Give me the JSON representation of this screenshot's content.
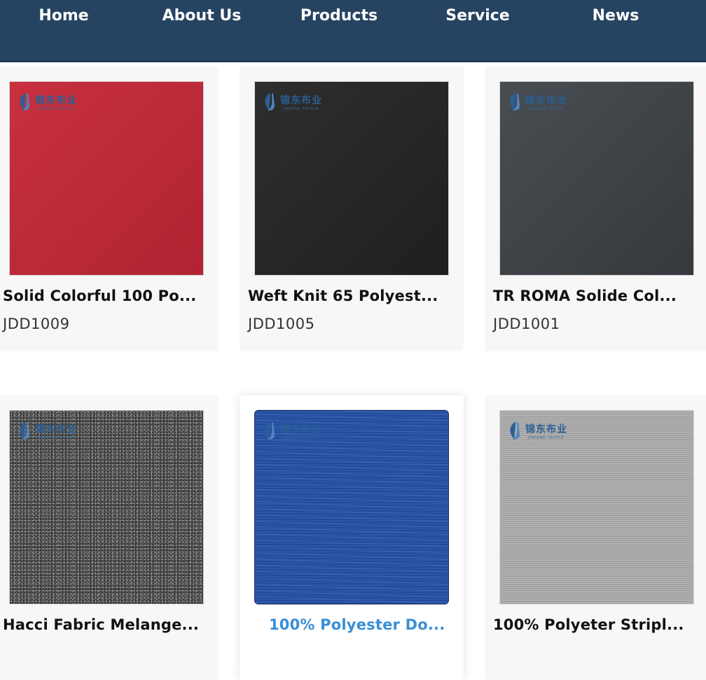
{
  "nav": {
    "items": [
      {
        "label": "Home"
      },
      {
        "label": "About Us"
      },
      {
        "label": "Products"
      },
      {
        "label": "Service"
      },
      {
        "label": "News"
      }
    ]
  },
  "logo": {
    "chinese": "锦东布业",
    "english": "JINDONG TEXTILE"
  },
  "products": [
    {
      "title": "Solid Colorful 100 Po...",
      "code": "JDD1009",
      "swatch_color": "#c02d3b"
    },
    {
      "title": "Weft Knit 65 Polyest...",
      "code": "JDD1005",
      "swatch_color": "#282828"
    },
    {
      "title": "TR ROMA Solide Col...",
      "code": "JDD1001",
      "swatch_color": "#404448"
    },
    {
      "title": "Hacci Fabric Melange...",
      "code": "",
      "swatch_color": "#555555"
    },
    {
      "title": "100% Polyester Do...",
      "code": "",
      "swatch_color": "#2a55a6",
      "highlighted": true
    },
    {
      "title": "100% Polyeter Stripl...",
      "code": "",
      "swatch_color": "#a6a6a6"
    }
  ],
  "colors": {
    "nav_background": "#264462",
    "highlight_title": "#3a8ed6",
    "card_background": "#f7f7f7"
  }
}
